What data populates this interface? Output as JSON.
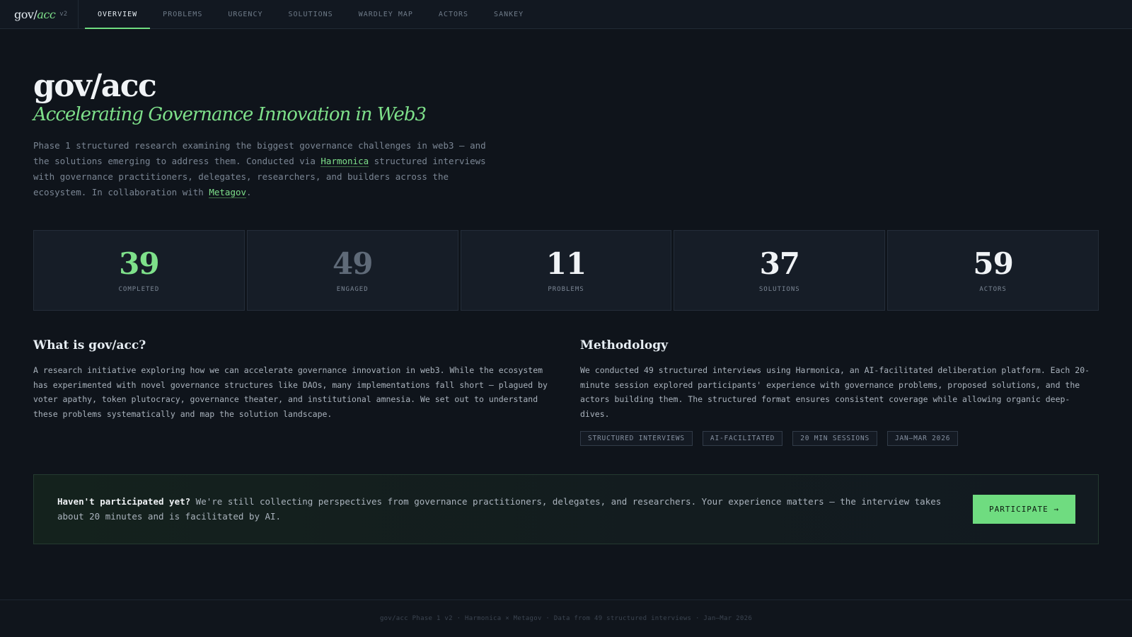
{
  "nav": {
    "brand": {
      "gov": "gov/",
      "acc": "acc",
      "version": "v2"
    },
    "tabs": [
      {
        "label": "OVERVIEW",
        "active": true
      },
      {
        "label": "PROBLEMS"
      },
      {
        "label": "URGENCY"
      },
      {
        "label": "SOLUTIONS"
      },
      {
        "label": "WARDLEY MAP"
      },
      {
        "label": "ACTORS"
      },
      {
        "label": "SANKEY"
      }
    ]
  },
  "hero": {
    "title": "gov/acc",
    "subtitle": "Accelerating Governance Innovation in Web3",
    "desc_1": "Phase 1 structured research examining the biggest governance challenges in web3 — and the solutions emerging to address them. Conducted via ",
    "link_harmonica": "Harmonica",
    "desc_2": " structured interviews with governance practitioners, delegates, researchers, and builders across the ecosystem. In collaboration with ",
    "link_metagov": "Metagov",
    "desc_3": "."
  },
  "stats": [
    {
      "value": "39",
      "label": "COMPLETED"
    },
    {
      "value": "49",
      "label": "ENGAGED"
    },
    {
      "value": "11",
      "label": "PROBLEMS"
    },
    {
      "value": "37",
      "label": "SOLUTIONS"
    },
    {
      "value": "59",
      "label": "ACTORS"
    }
  ],
  "about": {
    "title": "What is gov/acc?",
    "body": "A research initiative exploring how we can accelerate governance innovation in web3. While the ecosystem has experimented with novel governance structures like DAOs, many implementations fall short — plagued by voter apathy, token plutocracy, governance theater, and institutional amnesia. We set out to understand these problems systematically and map the solution landscape."
  },
  "methodology": {
    "title": "Methodology",
    "body": "We conducted 49 structured interviews using Harmonica, an AI-facilitated deliberation platform. Each 20-minute session explored participants' experience with governance problems, proposed solutions, and the actors building them. The structured format ensures consistent coverage while allowing organic deep-dives.",
    "tags": [
      "STRUCTURED INTERVIEWS",
      "AI-FACILITATED",
      "20 MIN SESSIONS",
      "JAN–MAR 2026"
    ]
  },
  "cta": {
    "strong": "Haven't participated yet?",
    "text": " We're still collecting perspectives from governance practitioners, delegates, and researchers. Your experience matters — the interview takes about 20 minutes and is facilitated by AI.",
    "button": "PARTICIPATE →"
  },
  "footer": {
    "text": "gov/acc Phase 1 v2 · Harmonica × Metagov · Data from 49 structured interviews · Jan–Mar 2026"
  }
}
